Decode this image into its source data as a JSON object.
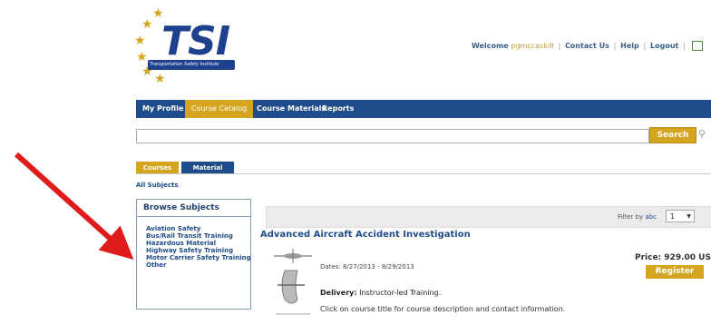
{
  "brand": {
    "logo_text": "TSI",
    "logo_subtitle": "Transportation Safety Institute"
  },
  "header": {
    "welcome_prefix": "Welcome",
    "username": "pgmccaskill",
    "links": [
      "Contact Us",
      "Help",
      "Logout"
    ]
  },
  "nav": {
    "items": [
      {
        "label": "My Profile",
        "active": false
      },
      {
        "label": "Course Catalog",
        "active": true
      },
      {
        "label": "Course Materials",
        "active": false
      },
      {
        "label": "Reports",
        "active": false
      }
    ]
  },
  "search": {
    "value": "",
    "button_label": "Search"
  },
  "tabs": [
    {
      "label": "Courses",
      "active": true
    },
    {
      "label": "Material",
      "active": false
    }
  ],
  "breadcrumb": "All Subjects",
  "browse": {
    "title": "Browse Subjects",
    "subjects": [
      "Aviation Safety",
      "Bus/Rail Transit Training",
      "Hazardous Material",
      "Highway Safety Training",
      "Motor Carrier Safety Training",
      "Other"
    ]
  },
  "filter": {
    "label": "Filter by",
    "option": "abc",
    "page_value": "1"
  },
  "course": {
    "title": "Advanced Aircraft Accident Investigation",
    "dates": "Dates:  8/27/2013 - 8/29/2013",
    "delivery_label": "Delivery:",
    "delivery_value": "Instructor-led Training.",
    "note": "Click on course title for course description and contact information.",
    "price": "Price: 929.00 US",
    "register_label": "Register"
  },
  "colors": {
    "nav_blue": "#1f4d8c",
    "accent_gold": "#d6a520",
    "annotation_red": "#e01b1b"
  },
  "icons": [
    "star-icon",
    "print-icon",
    "magnifier-icon",
    "chevron-down-icon",
    "annotation-arrow"
  ]
}
